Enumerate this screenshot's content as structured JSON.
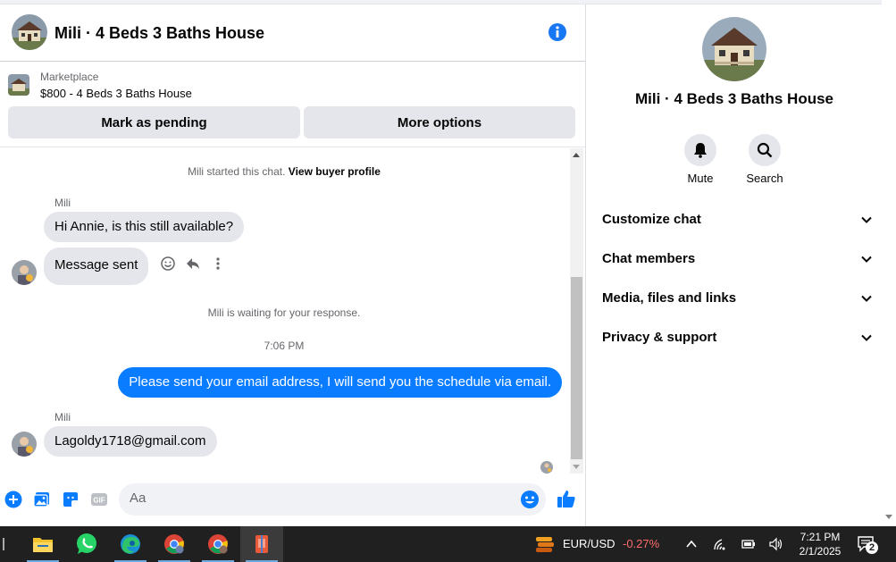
{
  "colors": {
    "accent": "#0a7cff",
    "info_blue": "#1877f2",
    "bubble_in": "#e4e6eb",
    "taskbar": "#202020",
    "negative": "#ff6b6b"
  },
  "header": {
    "title": "Mili · 4 Beds 3 Baths House",
    "info_icon": "info-icon"
  },
  "marketplace": {
    "label": "Marketplace",
    "listing": "$800 - 4 Beds 3 Baths House",
    "mark_pending": "Mark as pending",
    "more_options": "More options"
  },
  "messages": {
    "start_prefix": "Mili started this chat.",
    "view_buyer_profile": "View buyer profile",
    "sender_1": "Mili",
    "msg_1": "Hi Annie, is this still available?",
    "msg_2": "Message sent",
    "waiting": "Mili is waiting for your response.",
    "time": "7:06 PM",
    "msg_out": "Please send your email address, I will send you the schedule via email.",
    "sender_2": "Mili",
    "msg_3": "Lagoldy1718@gmail.com"
  },
  "composer": {
    "placeholder": "Aa"
  },
  "panel": {
    "title": "Mili · 4 Beds 3 Baths House",
    "mute": "Mute",
    "search": "Search",
    "sections": [
      "Customize chat",
      "Chat members",
      "Media, files and links",
      "Privacy & support"
    ]
  },
  "taskbar": {
    "apps": [
      "file-explorer",
      "whatsapp",
      "edge",
      "chrome",
      "chrome-profile",
      "active-app"
    ],
    "ticker": "EUR/USD",
    "ticker_change": "-0.27%",
    "time": "7:21 PM",
    "date": "2/1/2025",
    "notifications": "2"
  }
}
